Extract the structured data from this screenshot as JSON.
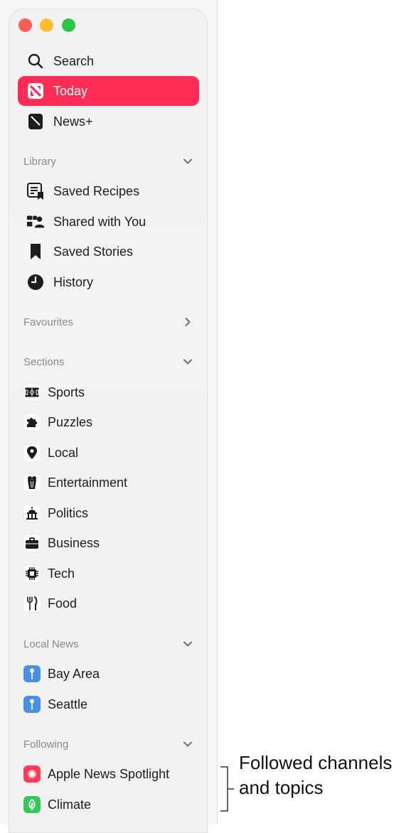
{
  "sidebar": {
    "top_items": [
      {
        "label": "Search",
        "icon": "search-icon"
      },
      {
        "label": "Today",
        "icon": "news-icon",
        "active": true
      },
      {
        "label": "News+",
        "icon": "news-plus-icon"
      }
    ],
    "library": {
      "title": "Library",
      "items": [
        {
          "label": "Saved Recipes",
          "icon": "saved-recipes-icon"
        },
        {
          "label": "Shared with You",
          "icon": "shared-with-you-icon"
        },
        {
          "label": "Saved Stories",
          "icon": "bookmark-icon"
        },
        {
          "label": "History",
          "icon": "clock-icon"
        }
      ]
    },
    "favourites": {
      "title": "Favourites"
    },
    "sections": {
      "title": "Sections",
      "items": [
        {
          "label": "Sports",
          "icon": "sports-icon"
        },
        {
          "label": "Puzzles",
          "icon": "puzzle-icon"
        },
        {
          "label": "Local",
          "icon": "location-pin-icon"
        },
        {
          "label": "Entertainment",
          "icon": "popcorn-icon"
        },
        {
          "label": "Politics",
          "icon": "capitol-icon"
        },
        {
          "label": "Business",
          "icon": "briefcase-icon"
        },
        {
          "label": "Tech",
          "icon": "chip-icon"
        },
        {
          "label": "Food",
          "icon": "fork-knife-icon"
        }
      ]
    },
    "local_news": {
      "title": "Local News",
      "items": [
        {
          "label": "Bay Area",
          "icon": "pin-icon"
        },
        {
          "label": "Seattle",
          "icon": "pin-icon"
        }
      ]
    },
    "following": {
      "title": "Following",
      "items": [
        {
          "label": "Apple News Spotlight",
          "icon": "spotlight-icon"
        },
        {
          "label": "Climate",
          "icon": "leaf-icon"
        }
      ]
    }
  },
  "annotation": {
    "line1": "Followed channels",
    "line2": "and topics"
  },
  "colors": {
    "accent": "#ff2d55",
    "pin_blue": "#4a90e2",
    "spotlight_red": "#ff3b5c",
    "climate_green": "#34c759"
  }
}
